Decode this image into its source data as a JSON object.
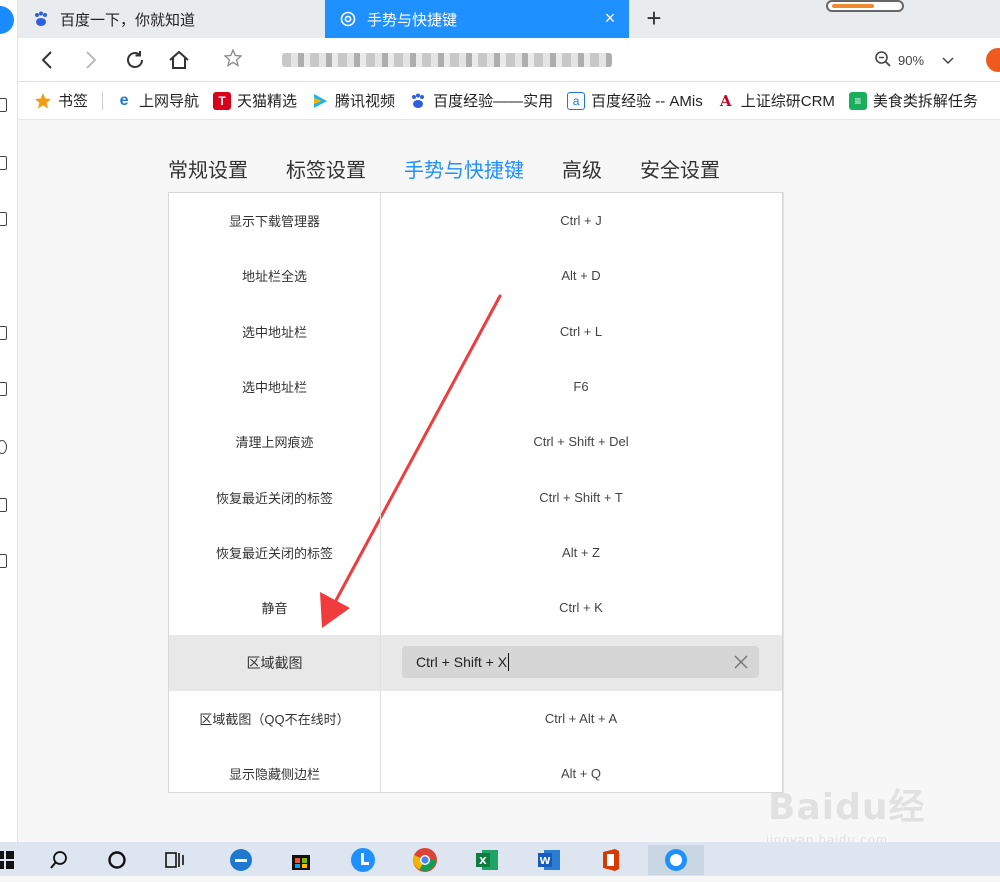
{
  "browser": {
    "tabs": [
      {
        "title": "百度一下，你就知道",
        "active": false,
        "icon": "baidu-paw-icon"
      },
      {
        "title": "手势与快捷键",
        "active": true,
        "icon": "gear-icon"
      }
    ],
    "zoom": "90%"
  },
  "bookmarks": [
    {
      "label": "书签",
      "icon": "star-icon"
    },
    {
      "label": "上网导航",
      "icon": "ie-icon"
    },
    {
      "label": "天猫精选",
      "icon": "tmall-icon"
    },
    {
      "label": "腾讯视频",
      "icon": "tencent-video-icon"
    },
    {
      "label": "百度经验——实用",
      "icon": "baidu-paw-icon"
    },
    {
      "label": "百度经验 -- AMis",
      "icon": "amis-icon"
    },
    {
      "label": "上证综研CRM",
      "icon": "crm-icon"
    },
    {
      "label": "美食类拆解任务",
      "icon": "sheet-icon"
    }
  ],
  "settings": {
    "tabs": [
      "常规设置",
      "标签设置",
      "手势与快捷键",
      "高级",
      "安全设置"
    ],
    "active_tab": "手势与快捷键",
    "rows": [
      {
        "action": "显示下载管理器",
        "shortcut": "Ctrl + J"
      },
      {
        "action": "地址栏全选",
        "shortcut": "Alt + D"
      },
      {
        "action": "选中地址栏",
        "shortcut": "Ctrl + L"
      },
      {
        "action": "选中地址栏",
        "shortcut": "F6"
      },
      {
        "action": "清理上网痕迹",
        "shortcut": "Ctrl + Shift + Del"
      },
      {
        "action": "恢复最近关闭的标签",
        "shortcut": "Ctrl + Shift + T"
      },
      {
        "action": "恢复最近关闭的标签",
        "shortcut": "Alt + Z"
      },
      {
        "action": "静音",
        "shortcut": "Ctrl + K"
      },
      {
        "action": "区域截图",
        "shortcut": "Ctrl + Shift + X",
        "editing": true
      },
      {
        "action": "区域截图（QQ不在线时）",
        "shortcut": "Ctrl + Alt + A"
      },
      {
        "action": "显示隐藏侧边栏",
        "shortcut": "Alt + Q"
      }
    ]
  },
  "watermark": {
    "brand": "Baidu经验",
    "url": "jingyan.baidu.com"
  },
  "colors": {
    "accent": "#1e90ff",
    "annotation": "#f03c3c"
  }
}
